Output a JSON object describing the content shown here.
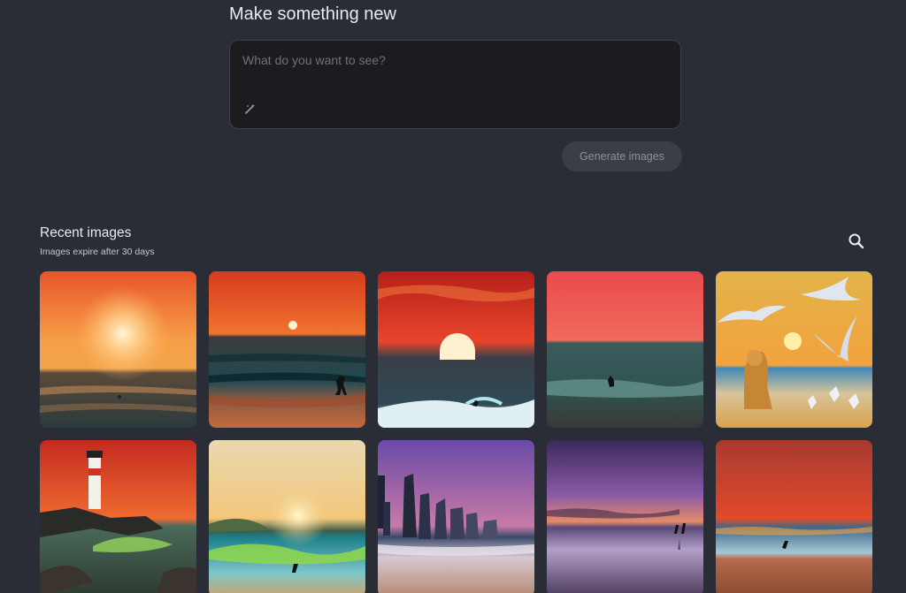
{
  "header": {
    "title": "Make something new"
  },
  "prompt": {
    "placeholder": "What do you want to see?",
    "value": ""
  },
  "actions": {
    "generate_label": "Generate images"
  },
  "recent": {
    "title": "Recent images",
    "subtitle": "Images expire after 30 days"
  },
  "icons": {
    "wand": "magic-wand-icon",
    "search": "search-icon"
  },
  "colors": {
    "background": "#2a2d36",
    "prompt_bg": "#1c1b20",
    "button_bg": "#3c3e47"
  }
}
